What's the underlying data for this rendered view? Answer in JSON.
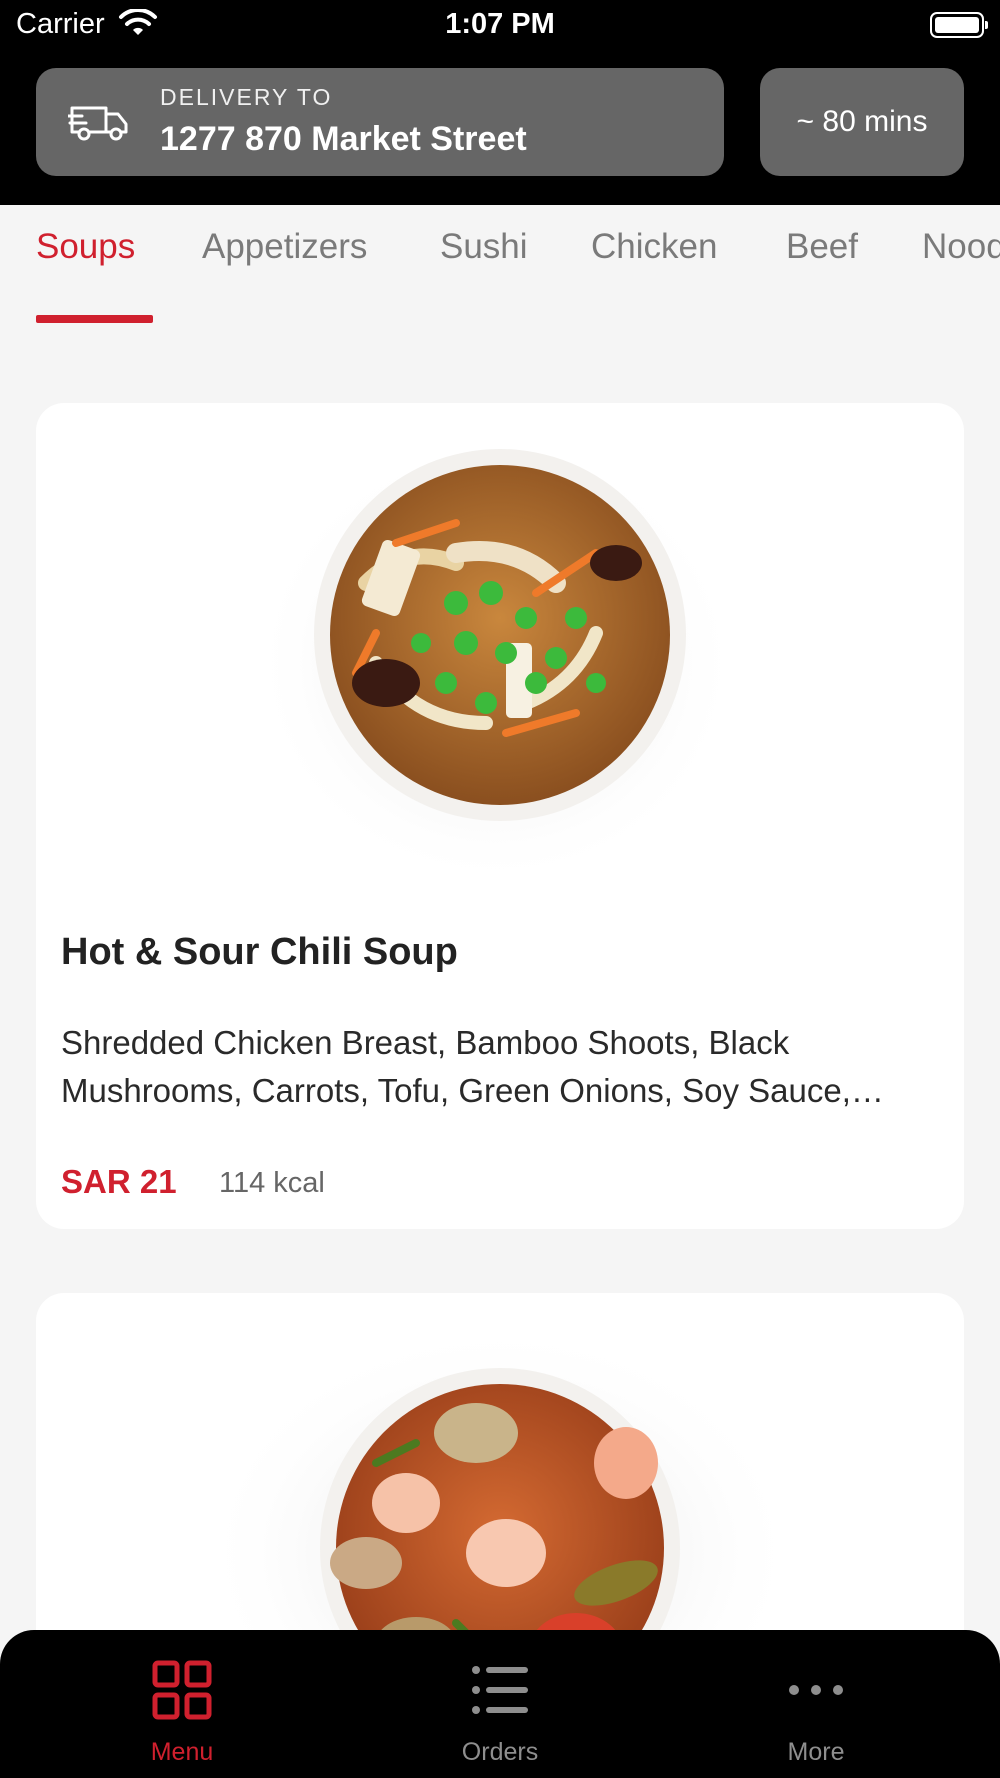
{
  "status_bar": {
    "carrier": "Carrier",
    "time": "1:07 PM"
  },
  "header": {
    "delivery_label": "DELIVERY TO",
    "address": "1277 870 Market Street",
    "eta": "~ 80 mins"
  },
  "categories": {
    "tabs": [
      {
        "label": "Soups",
        "active": true
      },
      {
        "label": "Appetizers",
        "active": false
      },
      {
        "label": "Sushi",
        "active": false
      },
      {
        "label": "Chicken",
        "active": false
      },
      {
        "label": "Beef",
        "active": false
      },
      {
        "label": "Noodles",
        "active": false
      }
    ]
  },
  "menu_items": [
    {
      "name": "Hot & Sour Chili Soup",
      "description": "Shredded Chicken Breast, Bamboo Shoots, Black Mushrooms, Carrots, Tofu, Green Onions,  Soy Sauce,…",
      "price": "SAR 21",
      "calories": "114 kcal"
    }
  ],
  "bottom_nav": {
    "items": [
      {
        "label": "Menu",
        "icon": "grid-icon",
        "active": true
      },
      {
        "label": "Orders",
        "icon": "list-icon",
        "active": false
      },
      {
        "label": "More",
        "icon": "more-icon",
        "active": false
      }
    ]
  },
  "colors": {
    "accent": "#d0202e",
    "header_bg": "#000000",
    "pill_bg": "#666666",
    "page_bg": "#f5f5f5"
  }
}
